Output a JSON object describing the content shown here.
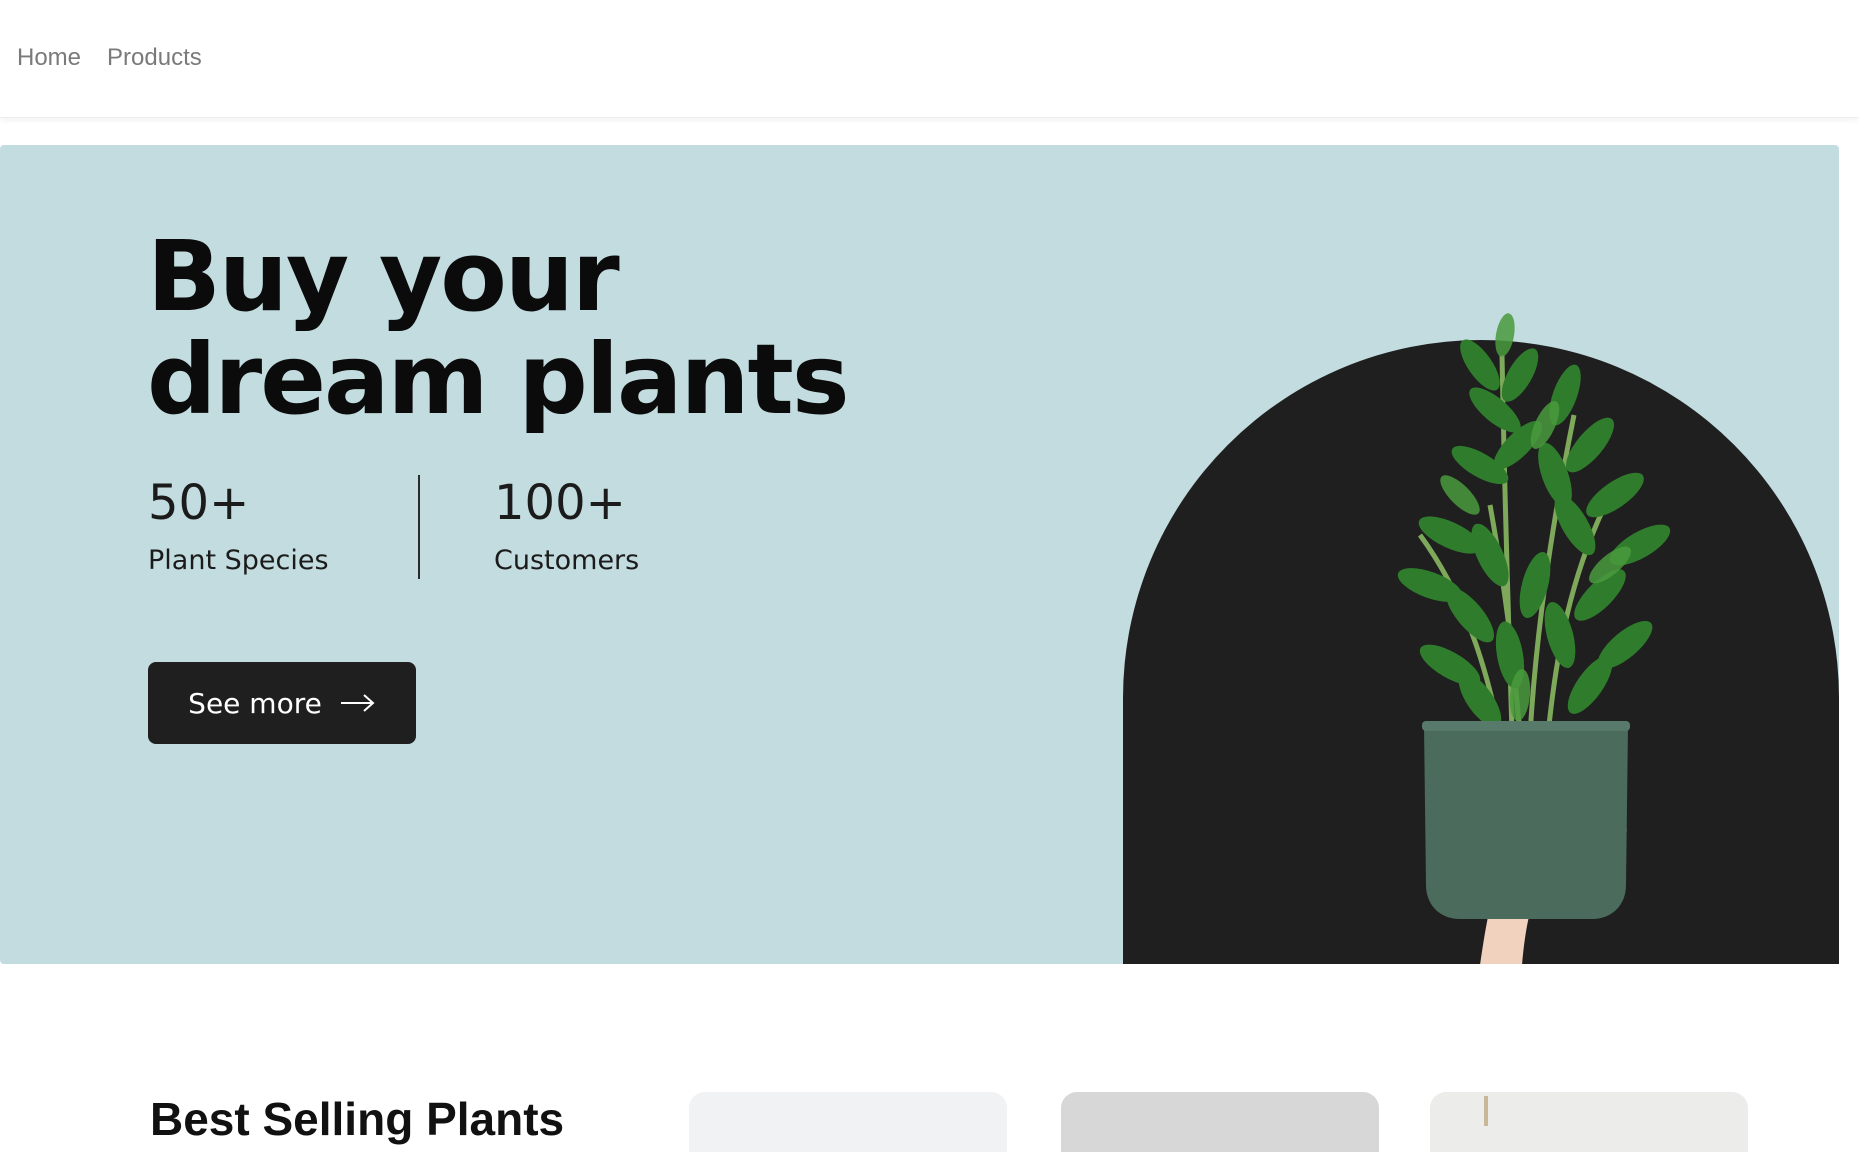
{
  "nav": {
    "links": [
      "Home",
      "Products"
    ]
  },
  "hero": {
    "title_line1": "Buy your",
    "title_line2": "dream plants",
    "stats": [
      {
        "value": "50+",
        "label": "Plant Species"
      },
      {
        "value": "100+",
        "label": "Customers"
      }
    ],
    "cta_label": "See more",
    "cta_icon": "arrow-right-icon",
    "image": "plant-in-pot"
  },
  "best_selling": {
    "title": "Best Selling Plants"
  },
  "colors": {
    "hero_background": "#c2dcdf",
    "arch": "#1f1f1f",
    "button": "#1f1f1f",
    "text": "#0b0b0b",
    "nav_link": "#7a7a7a"
  }
}
